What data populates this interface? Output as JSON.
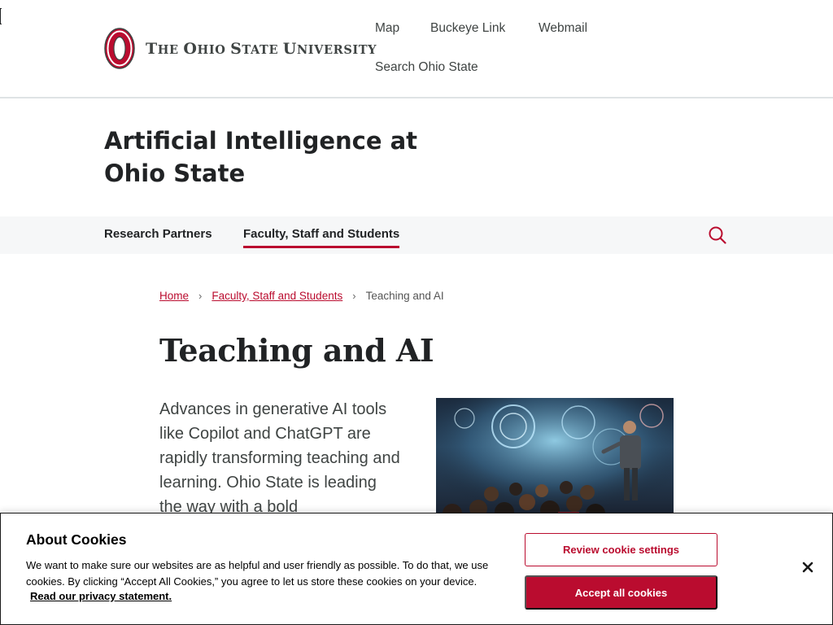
{
  "header": {
    "university_name": {
      "T": "T",
      "he": "HE ",
      "O": "O",
      "hio": "HIO ",
      "S": "S",
      "tate": "TATE ",
      "U": "U",
      "niversity": "NIVERSITY"
    },
    "links": [
      "Map",
      "Buckeye Link",
      "Webmail",
      "Search Ohio State"
    ]
  },
  "site": {
    "title": "Artificial Intelligence at Ohio State"
  },
  "nav": {
    "items": [
      "Research Partners",
      "Faculty, Staff and Students"
    ],
    "active_index": 1,
    "search_icon": "search-icon"
  },
  "breadcrumb": {
    "items": [
      "Home",
      "Faculty, Staff and Students"
    ],
    "current": "Teaching and AI",
    "separator": "›"
  },
  "page": {
    "title": "Teaching and AI",
    "intro": "Advances in generative AI tools like Copilot and ChatGPT are rapidly transforming teaching and learning. Ohio State is leading the way with a bold"
  },
  "cookie": {
    "title": "About Cookies",
    "text": "We want to make sure our websites are as helpful and user friendly as possible. To do that, we use cookies. By clicking “Accept All Cookies,” you agree to let us store these cookies on your device.",
    "link": "Read our privacy statement.",
    "settings_button": "Review cookie settings",
    "accept_button": "Accept all cookies",
    "close_icon": "close-icon"
  },
  "colors": {
    "scarlet": "#ba0c2f",
    "gray": "#3f4443",
    "nav_bg": "#f6f7f8"
  }
}
